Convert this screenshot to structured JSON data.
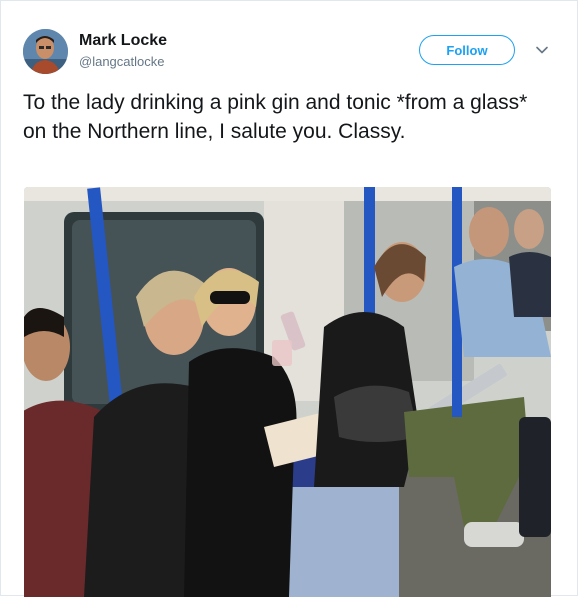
{
  "tweet": {
    "author_name": "Mark Locke",
    "author_handle": "@langcatlocke",
    "follow_label": "Follow",
    "text": "To the lady drinking a pink gin and tonic *from a glass* on the Northern line, I salute you. Classy."
  },
  "icons": {
    "menu": "chevron-down-icon"
  },
  "colors": {
    "accent": "#1da1f2",
    "text": "#14171a",
    "secondary": "#657786"
  }
}
